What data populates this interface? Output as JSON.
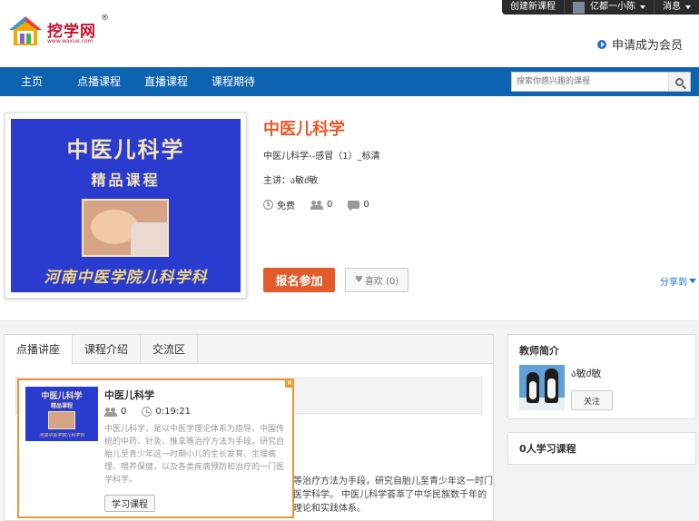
{
  "topbar": {
    "create_course": "创建新课程",
    "username": "亿都一小陈",
    "messages": "消息"
  },
  "header": {
    "logo_text": "挖学网",
    "logo_reg": "®",
    "logo_url": "www.waxue.com",
    "member_link": "申请成为会员"
  },
  "nav": {
    "items": [
      "主页",
      "点播课程",
      "直播课程",
      "课程期待"
    ],
    "search_placeholder": "搜索你感兴趣的课程"
  },
  "course": {
    "title": "中医儿科学",
    "subtitle": "中医儿科学--感冒（1）_标清",
    "teacher_label": "主讲：ა敏ძ敏",
    "price": "免费",
    "students": "0",
    "comments": "0",
    "enroll_label": "报名参加",
    "like_label": "喜欢 (0)",
    "share_label": "分享到",
    "cover": {
      "line1": "中医儿科学",
      "line2": "精品课程",
      "line3": "河南中医学院儿科学科"
    }
  },
  "tabs": [
    "点播讲座",
    "课程介绍",
    "交流区"
  ],
  "description_fragment": "等治疗方法为手段，研究自胎儿至青少年这一时门医学科学。 中医儿科学荟萃了中华民族数千年的理论和实践体系。",
  "popup": {
    "title": "中医儿科学",
    "students": "0",
    "duration": "0:19:21",
    "description": "中医儿科学，是以中医学理论体系为指导，中国传统的中药、针灸、推拿等治疗方法为手段，研究自胎儿至青少年这一时期小儿的生长发育、生理病理、喂养保健，以及各类疾病预防和治疗的一门医学科学。",
    "button": "学习课程",
    "close": "×",
    "cover": {
      "line1": "中医儿科学",
      "line2": "精品课程",
      "line3": "河南中医学院儿科学科"
    }
  },
  "sidebar": {
    "teacher_title": "教师简介",
    "teacher_name": "ა敏ძ敏",
    "follow_label": "关注",
    "learners_title": "0人学习课程"
  },
  "colors": {
    "nav": "#0d63b0",
    "accent": "#e35a2b",
    "popup_border": "#e8963c",
    "link": "#1a73c8"
  }
}
